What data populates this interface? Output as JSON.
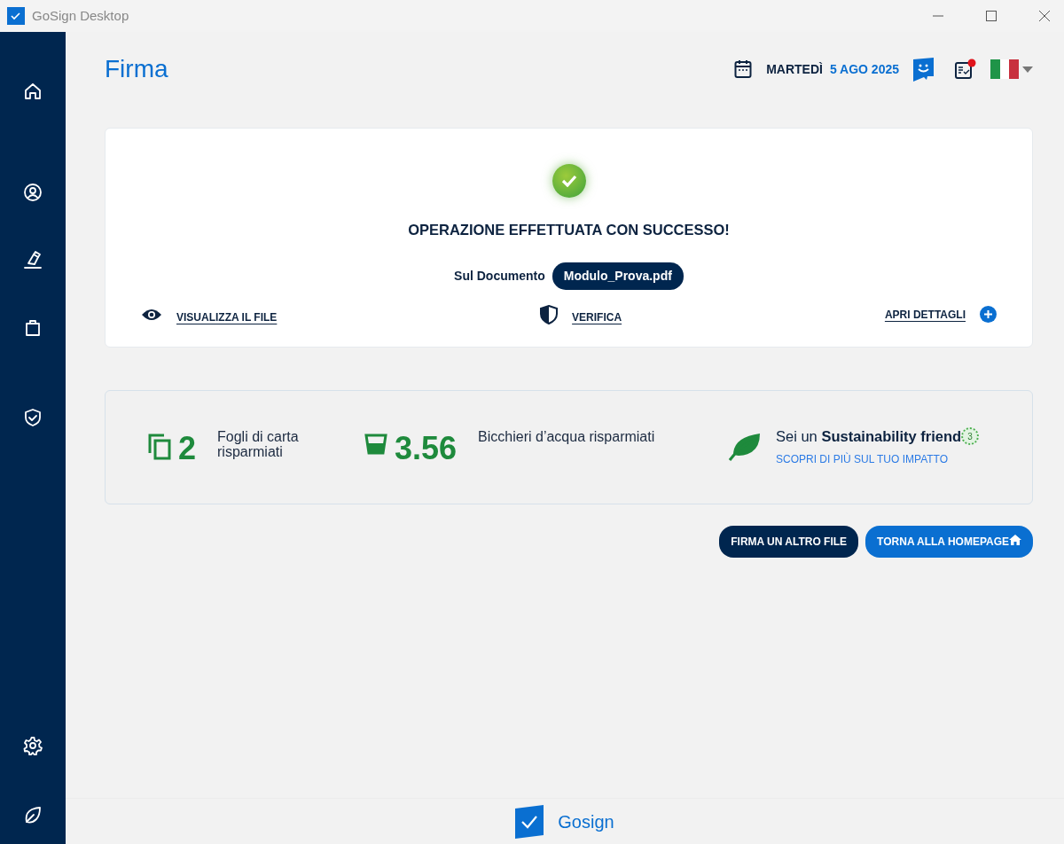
{
  "window": {
    "title": "GoSign Desktop"
  },
  "header": {
    "title": "Firma",
    "weekday": "MARTEDÌ",
    "date": "5 AGO 2025",
    "tasks_notification": true
  },
  "result": {
    "message": "OPERAZIONE EFFETTUATA CON SUCCESSO!",
    "document_label": "Sul Documento",
    "document_name": "Modulo_Prova.pdf",
    "actions": [
      {
        "kind": "view",
        "label": "VISUALIZZA IL FILE"
      },
      {
        "kind": "verify",
        "label": "VERIFICA"
      },
      {
        "kind": "details",
        "label": "APRI DETTAGLI"
      }
    ]
  },
  "savings": [
    {
      "kind": "paper",
      "value": "2",
      "label": "Fogli di carta risparmiati"
    },
    {
      "kind": "water",
      "value": "3.56",
      "label": "Bicchieri d’acqua risparmiati"
    }
  ],
  "sustainability": {
    "text": "Sei un **Sustainability friend**",
    "level_badge": "3",
    "link": "SCOPRI DI PIÙ SUL TUO IMPATTO"
  },
  "buttons": [
    {
      "kind": "dark",
      "label": "FIRMA UN ALTRO FILE"
    },
    {
      "kind": "home",
      "label": "TORNA ALLA HOMEPAGE"
    }
  ],
  "footer": {
    "brand": "Gosign"
  }
}
